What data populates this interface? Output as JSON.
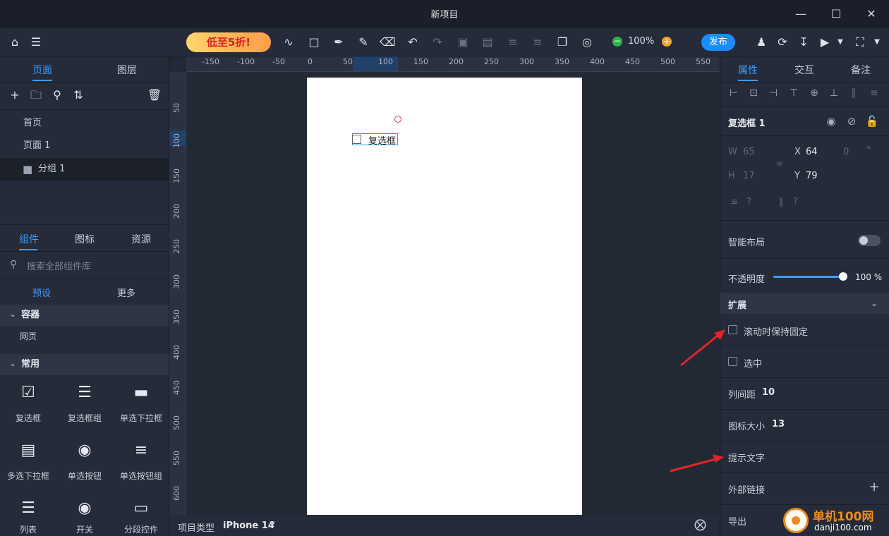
{
  "window": {
    "title": "新项目"
  },
  "toolbar": {
    "promo": "低至5折!",
    "zoom": "100%",
    "publish": "发布"
  },
  "left": {
    "tabs": [
      "页面",
      "图层"
    ],
    "pages": [
      "首页",
      "页面 1"
    ],
    "group": "分组 1",
    "comp_tabs": [
      "组件",
      "图标",
      "资源"
    ],
    "search_placeholder": "搜索全部组件库",
    "preset_tabs": [
      "预设",
      "更多"
    ],
    "section_container": "容器",
    "container_item": "网页",
    "section_common": "常用",
    "components": [
      "复选框",
      "复选框组",
      "单选下拉框",
      "多选下拉框",
      "单选按钮",
      "单选按钮组",
      "列表",
      "开关",
      "分段控件"
    ]
  },
  "canvas": {
    "ruler_top": [
      "-150",
      "-100",
      "-50",
      "0",
      "50",
      "100",
      "150",
      "200",
      "250",
      "300",
      "350",
      "400",
      "450",
      "500",
      "550"
    ],
    "ruler_left": [
      "50",
      "100",
      "150",
      "200",
      "250",
      "300",
      "350",
      "400",
      "450",
      "500",
      "550",
      "600"
    ],
    "checkbox_label": "复选框",
    "project_type_label": "项目类型",
    "project_type_value": "iPhone 14"
  },
  "right": {
    "tabs": [
      "属性",
      "交互",
      "备注"
    ],
    "element_name": "复选框 1",
    "w_label": "W",
    "w_value": "65",
    "h_label": "H",
    "h_value": "17",
    "x_label": "X",
    "x_value": "64",
    "y_label": "Y",
    "y_value": "79",
    "rotation": "0",
    "rotation_unit": "°",
    "q1": "?",
    "q2": "?",
    "smart_layout": "智能布局",
    "opacity_label": "不透明度",
    "opacity_value": "100 %",
    "opacity_fraction": 1.0,
    "extend": "扩展",
    "fixed_on_scroll": "滚动时保持固定",
    "checked": "选中",
    "col_gap_label": "列间距",
    "col_gap_value": "10",
    "icon_size_label": "图标大小",
    "icon_size_value": "13",
    "hint_text": "提示文字",
    "external_link": "外部链接",
    "export": "导出"
  },
  "watermark": {
    "name": "单机100网",
    "url": "danji100.com"
  },
  "colors": {
    "accent": "#3d9bff",
    "publish": "#1a8cff",
    "arrow": "#e0262a"
  }
}
